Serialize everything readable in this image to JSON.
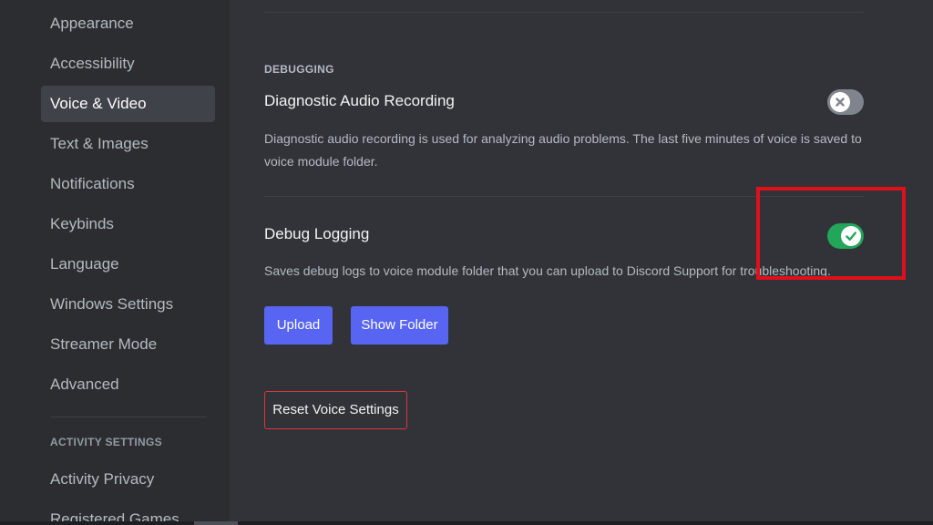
{
  "sidebar": {
    "items": [
      {
        "label": "Appearance"
      },
      {
        "label": "Accessibility"
      },
      {
        "label": "Voice & Video",
        "selected": true
      },
      {
        "label": "Text & Images"
      },
      {
        "label": "Notifications"
      },
      {
        "label": "Keybinds"
      },
      {
        "label": "Language"
      },
      {
        "label": "Windows Settings"
      },
      {
        "label": "Streamer Mode"
      },
      {
        "label": "Advanced"
      }
    ],
    "activity_header": "ACTIVITY SETTINGS",
    "activity_items": [
      {
        "label": "Activity Privacy"
      },
      {
        "label": "Registered Games"
      }
    ]
  },
  "debugging": {
    "header": "DEBUGGING",
    "diagnostic": {
      "title": "Diagnostic Audio Recording",
      "description": "Diagnostic audio recording is used for analyzing audio problems. The last five minutes of voice is saved to voice module folder.",
      "enabled": false
    },
    "debug_logging": {
      "title": "Debug Logging",
      "description": "Saves debug logs to voice module folder that you can upload to Discord Support for troubleshooting.",
      "enabled": true
    },
    "upload_label": "Upload",
    "show_folder_label": "Show Folder",
    "reset_label": "Reset Voice Settings"
  },
  "colors": {
    "accent": "#5865f2",
    "toggle_on": "#23a55a",
    "toggle_off": "#80848e",
    "danger": "#da373c",
    "highlight": "#e0101a"
  },
  "icons": {
    "toggle_off": "x-icon",
    "toggle_on": "check-icon"
  }
}
